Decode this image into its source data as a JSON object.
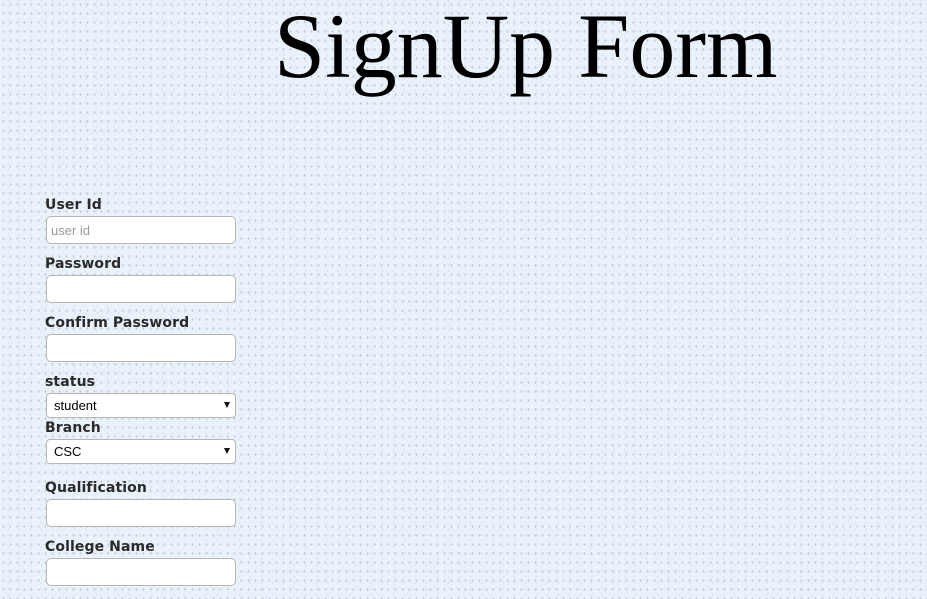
{
  "header": {
    "title": "SignUp Form"
  },
  "form": {
    "user_id": {
      "label": "User Id",
      "placeholder": "user id",
      "value": ""
    },
    "password": {
      "label": "Password",
      "value": ""
    },
    "confirm_password": {
      "label": "Confirm Password",
      "value": ""
    },
    "status": {
      "label": "status",
      "selected": "student"
    },
    "branch": {
      "label": "Branch",
      "selected": "CSC"
    },
    "qualification": {
      "label": "Qualification",
      "value": ""
    },
    "college_name": {
      "label": "College Name",
      "value": ""
    }
  }
}
